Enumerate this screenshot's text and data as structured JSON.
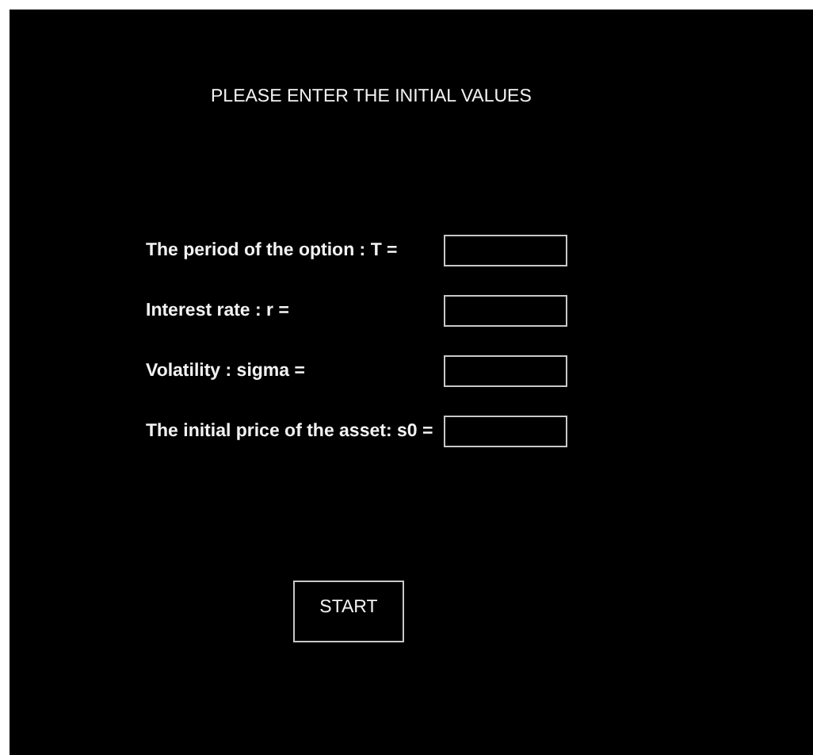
{
  "title": "PLEASE ENTER THE INITIAL VALUES",
  "fields": [
    {
      "label": "The period of the option : T ="
    },
    {
      "label": "Interest rate : r ="
    },
    {
      "label": "Volatility : sigma ="
    },
    {
      "label": "The initial price of the asset: s0 ="
    }
  ],
  "button": "START"
}
